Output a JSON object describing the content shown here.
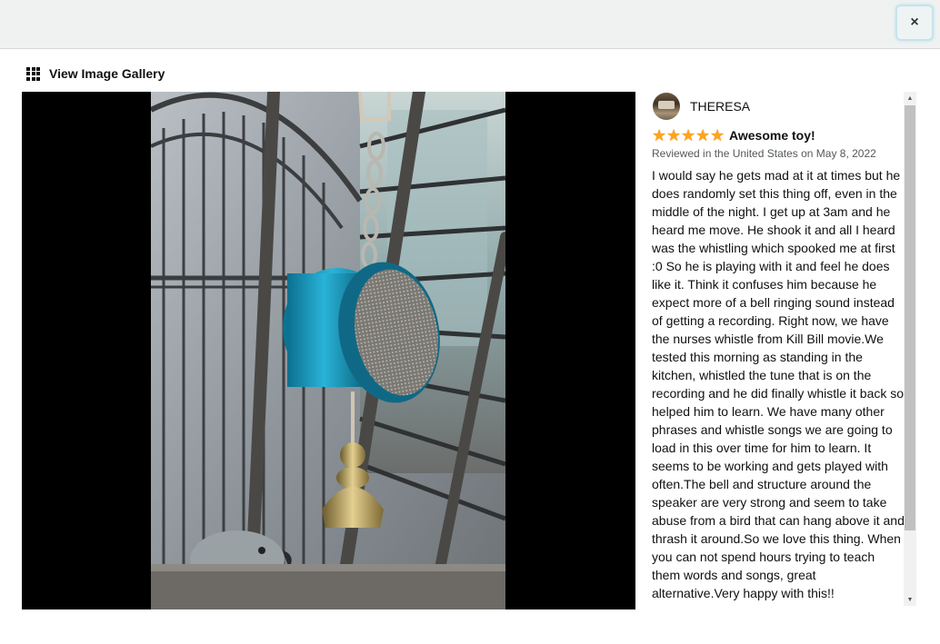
{
  "header": {
    "close_label": "×"
  },
  "gallery": {
    "link_label": "View Image Gallery",
    "icon": "grid-icon"
  },
  "media": {
    "icon": "photo",
    "accent": "#1f9bc4"
  },
  "review": {
    "reviewer_name": "THERESA",
    "rating": 5,
    "rating_max": 5,
    "stars": [
      "★",
      "★",
      "★",
      "★",
      "★"
    ],
    "star_color": "#ffa41c",
    "title": "Awesome toy!",
    "meta": "Reviewed in the United States on May 8, 2022",
    "body": "I would say he gets mad at it at times but he does randomly set this thing off, even in the middle of the night. I get up at 3am and he heard me move. He shook it and all I heard was the whistling which spooked me at first :0 So he is playing with it and feel he does like it. Think it confuses him because he expect more of a bell ringing sound instead of getting a recording. Right now, we have the nurses whistle from Kill Bill movie.We tested this morning as standing in the kitchen, whistled the tune that is on the recording and he did finally whistle it back so helped him to learn. We have many other phrases and whistle songs we are going to load in this over time for him to learn. It seems to be working and gets played with often.The bell and structure around the speaker are very strong and seem to take abuse from a bird that can hang above it and thrash it around.So we love this thing. When you can not spend hours trying to teach them words and songs, great alternative.Very happy with this!!"
  },
  "scrollbar": {
    "up": "▲",
    "down": "▼"
  }
}
